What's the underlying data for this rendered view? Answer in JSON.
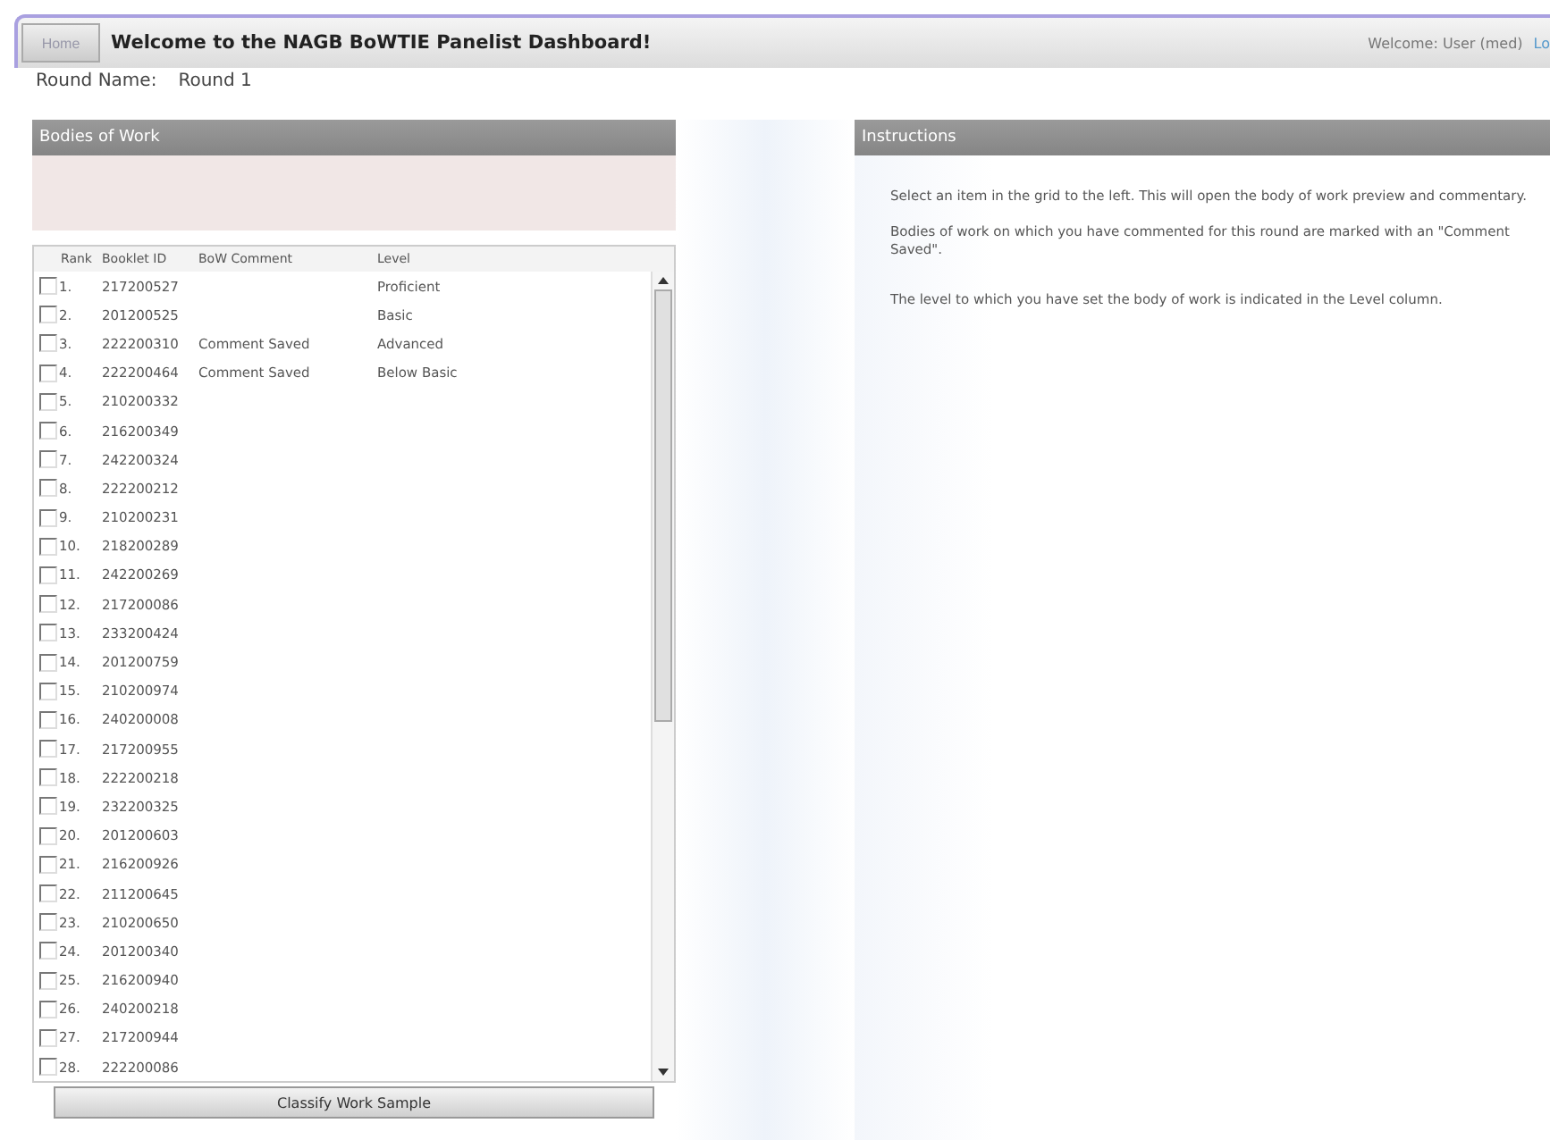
{
  "header": {
    "home_button": "Home",
    "title": "Welcome to the NAGB BoWTIE Panelist Dashboard!",
    "user_text": "Welcome: User (med)",
    "user_link": "Lo"
  },
  "round": {
    "label": "Round Name:",
    "value": "Round 1"
  },
  "bodies_panel": {
    "title": "Bodies of Work",
    "columns": [
      "Rank",
      "Booklet ID",
      "BoW Comment",
      "Level"
    ],
    "rows": [
      {
        "checked": false,
        "rank": "1.",
        "booklet_id": "217200527",
        "comment": "",
        "level": "Proficient"
      },
      {
        "checked": false,
        "rank": "2.",
        "booklet_id": "201200525",
        "comment": "",
        "level": "Basic"
      },
      {
        "checked": false,
        "rank": "3.",
        "booklet_id": "222200310",
        "comment": "Comment Saved",
        "level": "Advanced"
      },
      {
        "checked": false,
        "rank": "4.",
        "booklet_id": "222200464",
        "comment": "Comment Saved",
        "level": "Below Basic"
      },
      {
        "checked": false,
        "rank": "5.",
        "booklet_id": "210200332",
        "comment": "",
        "level": ""
      },
      {
        "checked": false,
        "rank": "6.",
        "booklet_id": "216200349",
        "comment": "",
        "level": ""
      },
      {
        "checked": false,
        "rank": "7.",
        "booklet_id": "242200324",
        "comment": "",
        "level": ""
      },
      {
        "checked": false,
        "rank": "8.",
        "booklet_id": "222200212",
        "comment": "",
        "level": ""
      },
      {
        "checked": false,
        "rank": "9.",
        "booklet_id": "210200231",
        "comment": "",
        "level": ""
      },
      {
        "checked": false,
        "rank": "10.",
        "booklet_id": "218200289",
        "comment": "",
        "level": ""
      },
      {
        "checked": false,
        "rank": "11.",
        "booklet_id": "242200269",
        "comment": "",
        "level": ""
      },
      {
        "checked": false,
        "rank": "12.",
        "booklet_id": "217200086",
        "comment": "",
        "level": ""
      },
      {
        "checked": false,
        "rank": "13.",
        "booklet_id": "233200424",
        "comment": "",
        "level": ""
      },
      {
        "checked": false,
        "rank": "14.",
        "booklet_id": "201200759",
        "comment": "",
        "level": ""
      },
      {
        "checked": false,
        "rank": "15.",
        "booklet_id": "210200974",
        "comment": "",
        "level": ""
      },
      {
        "checked": false,
        "rank": "16.",
        "booklet_id": "240200008",
        "comment": "",
        "level": ""
      },
      {
        "checked": false,
        "rank": "17.",
        "booklet_id": "217200955",
        "comment": "",
        "level": ""
      },
      {
        "checked": false,
        "rank": "18.",
        "booklet_id": "222200218",
        "comment": "",
        "level": ""
      },
      {
        "checked": false,
        "rank": "19.",
        "booklet_id": "232200325",
        "comment": "",
        "level": ""
      },
      {
        "checked": false,
        "rank": "20.",
        "booklet_id": "201200603",
        "comment": "",
        "level": ""
      },
      {
        "checked": false,
        "rank": "21.",
        "booklet_id": "216200926",
        "comment": "",
        "level": ""
      },
      {
        "checked": false,
        "rank": "22.",
        "booklet_id": "211200645",
        "comment": "",
        "level": ""
      },
      {
        "checked": false,
        "rank": "23.",
        "booklet_id": "210200650",
        "comment": "",
        "level": ""
      },
      {
        "checked": false,
        "rank": "24.",
        "booklet_id": "201200340",
        "comment": "",
        "level": ""
      },
      {
        "checked": false,
        "rank": "25.",
        "booklet_id": "216200940",
        "comment": "",
        "level": ""
      },
      {
        "checked": false,
        "rank": "26.",
        "booklet_id": "240200218",
        "comment": "",
        "level": ""
      },
      {
        "checked": false,
        "rank": "27.",
        "booklet_id": "217200944",
        "comment": "",
        "level": ""
      },
      {
        "checked": false,
        "rank": "28.",
        "booklet_id": "222200086",
        "comment": "",
        "level": ""
      }
    ],
    "button": "Classify Work Sample"
  },
  "instructions_panel": {
    "title": "Instructions",
    "paragraphs": [
      "Select an item in the grid to the left. This will open the body of work preview and commentary.",
      "Bodies of work on which you have commented for this round are marked with an \"Comment Saved\".",
      "The level to which you have set the body of work is indicated in the Level column."
    ]
  }
}
